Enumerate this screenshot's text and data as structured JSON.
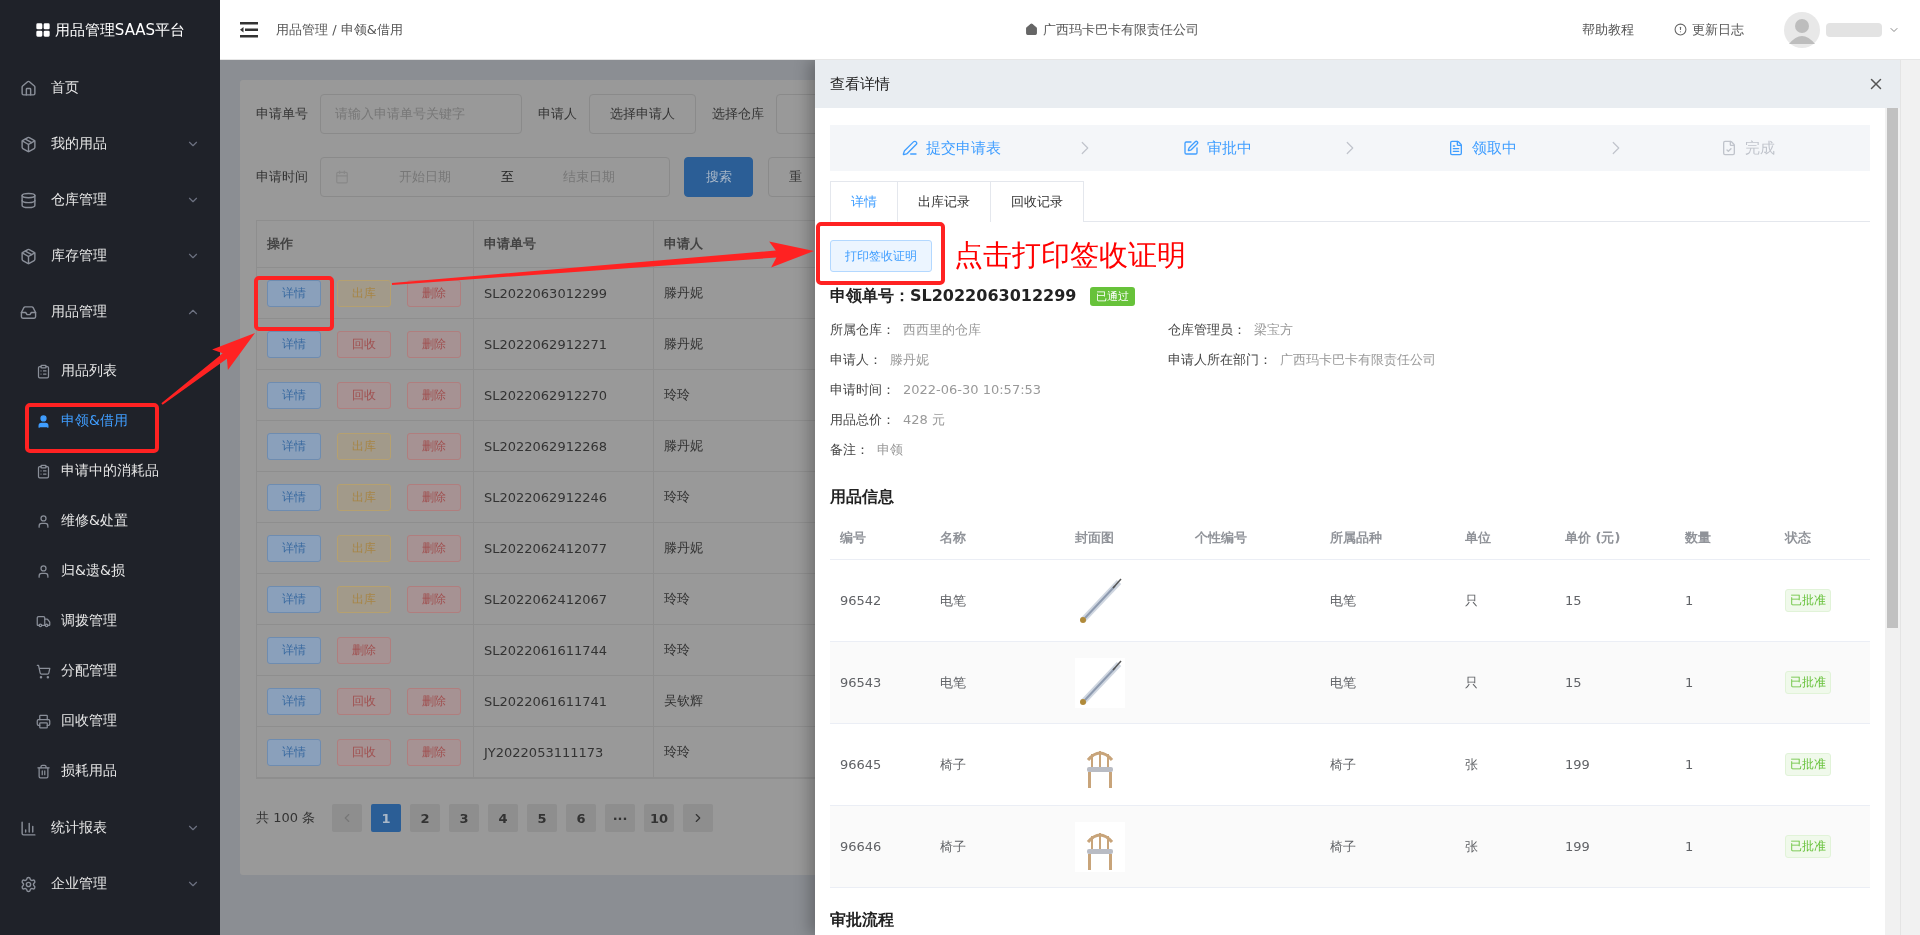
{
  "app": {
    "title": "用品管理SAAS平台"
  },
  "sidebar": {
    "items": [
      {
        "label": "首页"
      },
      {
        "label": "我的用品",
        "expanded": false
      },
      {
        "label": "仓库管理",
        "expanded": false
      },
      {
        "label": "库存管理",
        "expanded": false
      },
      {
        "label": "用品管理",
        "expanded": true,
        "children": [
          {
            "label": "用品列表",
            "selected": false
          },
          {
            "label": "申领&借用",
            "selected": true
          },
          {
            "label": "申请中的消耗品",
            "selected": false
          },
          {
            "label": "维修&处置",
            "selected": false
          },
          {
            "label": "归&遗&损",
            "selected": false
          },
          {
            "label": "调拨管理",
            "selected": false
          },
          {
            "label": "分配管理",
            "selected": false
          },
          {
            "label": "回收管理",
            "selected": false
          },
          {
            "label": "损耗用品",
            "selected": false
          }
        ]
      },
      {
        "label": "统计报表",
        "expanded": false
      },
      {
        "label": "企业管理",
        "expanded": false
      }
    ]
  },
  "topbar": {
    "breadcrumb": "用品管理 / 申领&借用",
    "links": [
      "广西玛卡巴卡有限责任公司",
      "帮助教程",
      "更新日志"
    ]
  },
  "filters": {
    "order_no": {
      "label": "申请单号",
      "placeholder": "请输入申请单号关键字"
    },
    "applicant": {
      "label": "申请人",
      "value": "选择申请人"
    },
    "warehouse": {
      "label": "选择仓库"
    },
    "time": {
      "label": "申请时间",
      "start_placeholder": "开始日期",
      "separator": "至",
      "end_placeholder": "结束日期"
    },
    "buttons": [
      {
        "label": "搜索",
        "kind": "primary"
      },
      {
        "label": "重",
        "kind": "default"
      }
    ]
  },
  "table": {
    "columns": [
      "操作",
      "申请单号",
      "申请人"
    ],
    "rows": [
      {
        "actions": [
          {
            "label": "详情",
            "kind": "detail"
          },
          {
            "label": "出库",
            "kind": "outbound"
          },
          {
            "label": "删除",
            "kind": "delete"
          }
        ],
        "order_no": "SL2022063012299",
        "applicant": "滕丹妮"
      },
      {
        "actions": [
          {
            "label": "详情",
            "kind": "detail"
          },
          {
            "label": "回收",
            "kind": "recycle"
          },
          {
            "label": "删除",
            "kind": "delete"
          }
        ],
        "order_no": "SL2022062912271",
        "applicant": "滕丹妮"
      },
      {
        "actions": [
          {
            "label": "详情",
            "kind": "detail"
          },
          {
            "label": "回收",
            "kind": "recycle"
          },
          {
            "label": "删除",
            "kind": "delete"
          }
        ],
        "order_no": "SL2022062912270",
        "applicant": "玲玲"
      },
      {
        "actions": [
          {
            "label": "详情",
            "kind": "detail"
          },
          {
            "label": "出库",
            "kind": "outbound"
          },
          {
            "label": "删除",
            "kind": "delete"
          }
        ],
        "order_no": "SL2022062912268",
        "applicant": "滕丹妮"
      },
      {
        "actions": [
          {
            "label": "详情",
            "kind": "detail"
          },
          {
            "label": "出库",
            "kind": "outbound"
          },
          {
            "label": "删除",
            "kind": "delete"
          }
        ],
        "order_no": "SL2022062912246",
        "applicant": "玲玲"
      },
      {
        "actions": [
          {
            "label": "详情",
            "kind": "detail"
          },
          {
            "label": "出库",
            "kind": "outbound"
          },
          {
            "label": "删除",
            "kind": "delete"
          }
        ],
        "order_no": "SL2022062412077",
        "applicant": "滕丹妮"
      },
      {
        "actions": [
          {
            "label": "详情",
            "kind": "detail"
          },
          {
            "label": "出库",
            "kind": "outbound"
          },
          {
            "label": "删除",
            "kind": "delete"
          }
        ],
        "order_no": "SL2022062412067",
        "applicant": "玲玲"
      },
      {
        "actions": [
          {
            "label": "详情",
            "kind": "detail"
          },
          {
            "label": "删除",
            "kind": "delete"
          }
        ],
        "order_no": "SL2022061611744",
        "applicant": "玲玲"
      },
      {
        "actions": [
          {
            "label": "详情",
            "kind": "detail"
          },
          {
            "label": "回收",
            "kind": "recycle"
          },
          {
            "label": "删除",
            "kind": "delete"
          }
        ],
        "order_no": "SL2022061611741",
        "applicant": "吴钦辉"
      },
      {
        "actions": [
          {
            "label": "详情",
            "kind": "detail"
          },
          {
            "label": "回收",
            "kind": "recycle"
          },
          {
            "label": "删除",
            "kind": "delete"
          }
        ],
        "order_no": "JY2022053111173",
        "applicant": "玲玲"
      }
    ]
  },
  "pagination": {
    "total": "共 100 条",
    "prev_disabled": true,
    "next_disabled": false,
    "pages": [
      {
        "label": "1",
        "selected": true
      },
      {
        "label": "2",
        "selected": false
      },
      {
        "label": "3",
        "selected": false
      },
      {
        "label": "4",
        "selected": false
      },
      {
        "label": "5",
        "selected": false
      },
      {
        "label": "6",
        "selected": false
      },
      {
        "label": "···",
        "selected": false
      },
      {
        "label": "10",
        "selected": false
      }
    ]
  },
  "drawer": {
    "title": "查看详情",
    "steps": [
      {
        "label": "提交申请表",
        "done": true
      },
      {
        "label": "审批中",
        "done": true
      },
      {
        "label": "领取中",
        "done": true
      },
      {
        "label": "完成",
        "done": false
      }
    ],
    "tabs": [
      {
        "label": "详情",
        "selected": true
      },
      {
        "label": "出库记录",
        "selected": false
      },
      {
        "label": "回收记录",
        "selected": false
      }
    ],
    "print_button": "打印签收证明",
    "print_hint": "点击打印签收证明",
    "order_title": "申领单号：SL2022063012299",
    "status": "已通过",
    "info_left": [
      {
        "label": "所属仓库：",
        "value": "西西里的仓库"
      },
      {
        "label": "申请人：",
        "value": "滕丹妮"
      },
      {
        "label": "申请时间：",
        "value": "2022-06-30 10:57:53"
      },
      {
        "label": "用品总价：",
        "value": "428 元"
      },
      {
        "label": "备注：",
        "value": "申领"
      }
    ],
    "info_right": [
      {
        "label": "仓库管理员：",
        "value": "梁宝方"
      },
      {
        "label": "申请人所在部门：",
        "value": "广西玛卡巴卡有限责任公司"
      }
    ],
    "items_title": "用品信息",
    "item_columns": [
      "编号",
      "名称",
      "封面图",
      "个性编号",
      "所属品种",
      "单位",
      "单价 (元)",
      "数量",
      "状态"
    ],
    "items": [
      {
        "no": "96542",
        "name": "电笔",
        "category": "电笔",
        "unit": "只",
        "price": "15",
        "qty": "1",
        "status": "已批准"
      },
      {
        "no": "96543",
        "name": "电笔",
        "category": "电笔",
        "unit": "只",
        "price": "15",
        "qty": "1",
        "status": "已批准"
      },
      {
        "no": "96645",
        "name": "椅子",
        "category": "椅子",
        "unit": "张",
        "price": "199",
        "qty": "1",
        "status": "已批准"
      },
      {
        "no": "96646",
        "name": "椅子",
        "category": "椅子",
        "unit": "张",
        "price": "199",
        "qty": "1",
        "status": "已批准"
      }
    ],
    "next_section": "审批流程"
  }
}
